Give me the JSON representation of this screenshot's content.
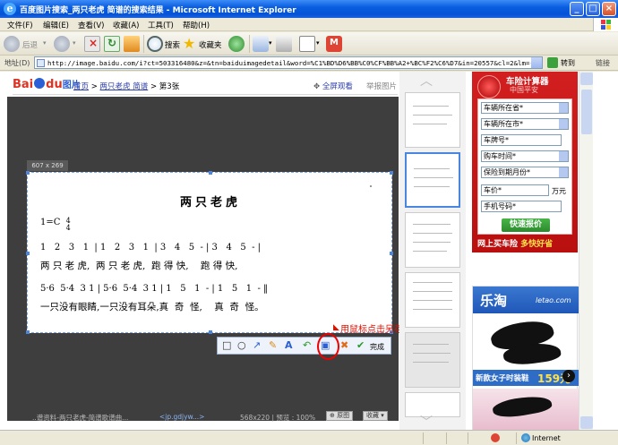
{
  "window": {
    "title": "百度图片搜索_两只老虎  简谱的搜索结果 - Microsoft Internet Explorer"
  },
  "menu": [
    "文件(F)",
    "编辑(E)",
    "查看(V)",
    "收藏(A)",
    "工具(T)",
    "帮助(H)"
  ],
  "toolbar": {
    "back_label": "后退",
    "search_label": "搜索",
    "favorites_label": "收藏夹"
  },
  "address": {
    "label": "地址(D)",
    "url": "http://image.baidu.com/i?ct=503316480&z=&tn=baiduimagedetail&word=%C1%BD%D6%BB%C0%CF%BB%A2+%BC%F2%C6%D7&in=20557&cl=2&lm=-1&pn=1&rn=1&di=0",
    "go_label": "转到",
    "links_label": "链接"
  },
  "baidu": {
    "logo_text": "Bai",
    "logo_text2": "du",
    "logo_tu": "图片",
    "crumb_home": "首页",
    "crumb_sep1": " > ",
    "crumb_query": "两只老虎 简谱",
    "crumb_sep2": " > ",
    "crumb_current": "第3张",
    "fullview": "全屏观看",
    "report": "举报图片"
  },
  "viewer": {
    "size_tag": "607 x 269",
    "song_title": "两只老虎",
    "key": "1=C",
    "time_top": "4",
    "time_bottom": "4",
    "notes_line1": "1   2   3   1  | 1   2   3   1  | 3   4   5  - | 3   4   5  - |",
    "lyrics_line1": "两 只 老 虎,  两 只 老 虎,  跑 得 快,    跑 得 快,",
    "notes_line2": "5·6  5·4  3 1 | 5·6  5·4  3 1 | 1   5   1  - | 1   5   1  - ‖",
    "lyrics_line2": "一只没有眼睛,一只没有耳朵,真  奇  怪,    真  奇  怪。",
    "annotation": "用鼠标点击另存为",
    "done_label": "完成",
    "bottom_left": "..谱资料-两只老虎-简谱歌谱曲...",
    "bottom_link": "<jp.gdjyw...>",
    "bottom_size": "568x220 | 预览 : 100%",
    "btn_original": "原图",
    "btn_fav": "收藏"
  },
  "ad_car": {
    "title": "车险计算器",
    "subtitle": "中国平安",
    "fields": [
      "车辆所在省*",
      "车辆所在市*",
      "车牌号*",
      "购车时间*",
      "保险到期月份*",
      "车价*",
      "手机号码*"
    ],
    "unit": "万元",
    "button": "快速报价",
    "footer": "网上买车险",
    "footer_hl": "多快好省"
  },
  "ad_shoes": {
    "logo": "乐淘",
    "domain": "letao.com",
    "banner": "新款女子时装鞋",
    "price": "159元"
  },
  "status": {
    "zone": "Internet"
  }
}
